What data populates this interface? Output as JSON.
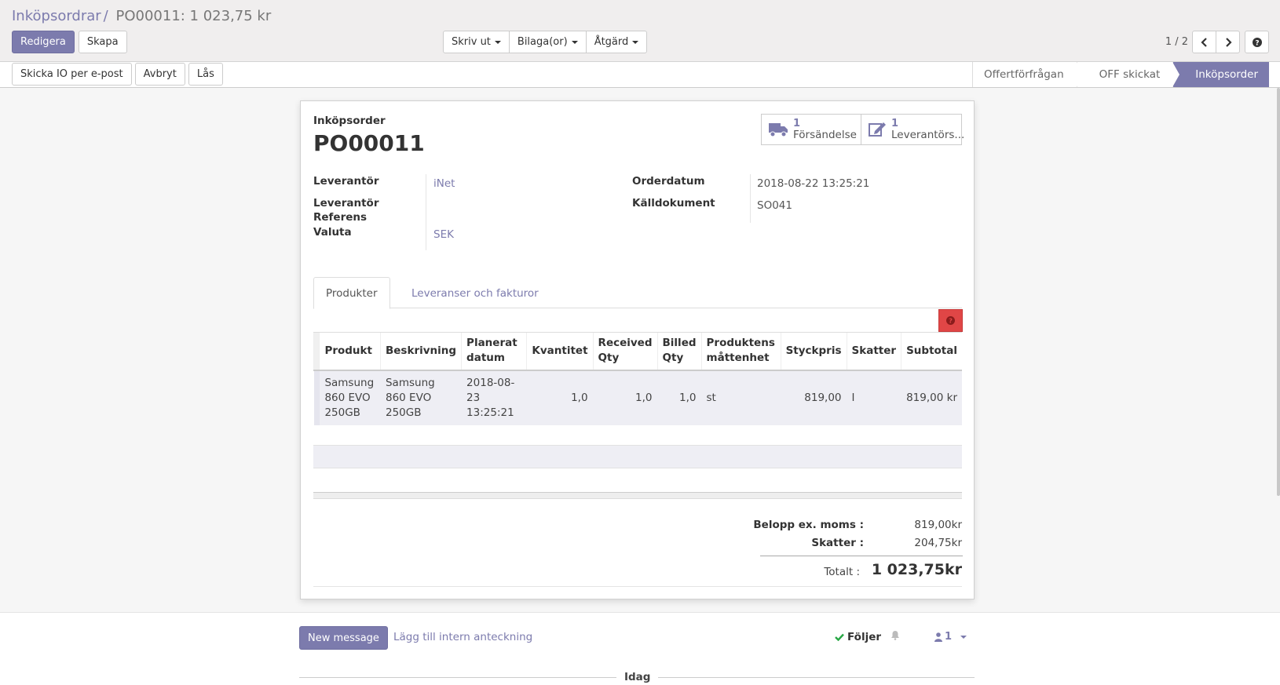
{
  "breadcrumb": {
    "parent": "Inköpsordrar",
    "separator": "/",
    "current": "PO00011: 1 023,75 kr"
  },
  "toolbar": {
    "edit": "Redigera",
    "create": "Skapa",
    "print": "Skriv ut",
    "attachments": "Bilaga(or)",
    "action": "Åtgärd"
  },
  "pager": {
    "value": "1 / 2"
  },
  "statusbar": {
    "send_po": "Skicka IO per e-post",
    "cancel": "Avbryt",
    "lock": "Lås",
    "stages": [
      "Offertförfrågan",
      "OFF skickat",
      "Inköpsorder"
    ],
    "active_stage": "Inköpsorder"
  },
  "sheet": {
    "subtitle": "Inköpsorder",
    "name": "PO00011",
    "smart_buttons": [
      {
        "count": "1",
        "label": "Försändelse",
        "icon": "truck-icon"
      },
      {
        "count": "1",
        "label": "Leverantörs...",
        "icon": "edit-icon"
      }
    ],
    "fields": {
      "vendor_label": "Leverantör",
      "vendor_value": "iNet",
      "vendor_ref_label_1": "Leverantör",
      "vendor_ref_label_2": "Referens",
      "currency_label": "Valuta",
      "currency_value": "SEK",
      "order_date_label": "Orderdatum",
      "order_date_value": "2018-08-22 13:25:21",
      "source_label": "Källdokument",
      "source_value": "SO041"
    },
    "tabs": [
      "Produkter",
      "Leveranser och fakturor"
    ],
    "table": {
      "headers": [
        "Produkt",
        "Beskrivning",
        "Planerat datum",
        "Kvantitet",
        "Received Qty",
        "Billed Qty",
        "Produktens måttenhet",
        "Styckpris",
        "Skatter",
        "Subtotal"
      ],
      "rows": [
        [
          "Samsung 860 EVO 250GB",
          "Samsung 860 EVO 250GB",
          "2018-08-23 13:25:21",
          "1,0",
          "1,0",
          "1,0",
          "st",
          "819,00",
          "I",
          "819,00 kr"
        ]
      ]
    },
    "totals": {
      "untaxed_label": "Belopp ex. moms :",
      "untaxed_value": "819,00kr",
      "tax_label": "Skatter :",
      "tax_value": "204,75kr",
      "total_label": "Totalt :",
      "total_value": "1 023,75kr"
    }
  },
  "chatter": {
    "new_message": "New message",
    "log_note": "Lägg till intern anteckning",
    "following": "Följer",
    "followers_count": "1",
    "today": "Idag"
  },
  "colors": {
    "accent": "#7c7bad",
    "help": "#e04646"
  }
}
